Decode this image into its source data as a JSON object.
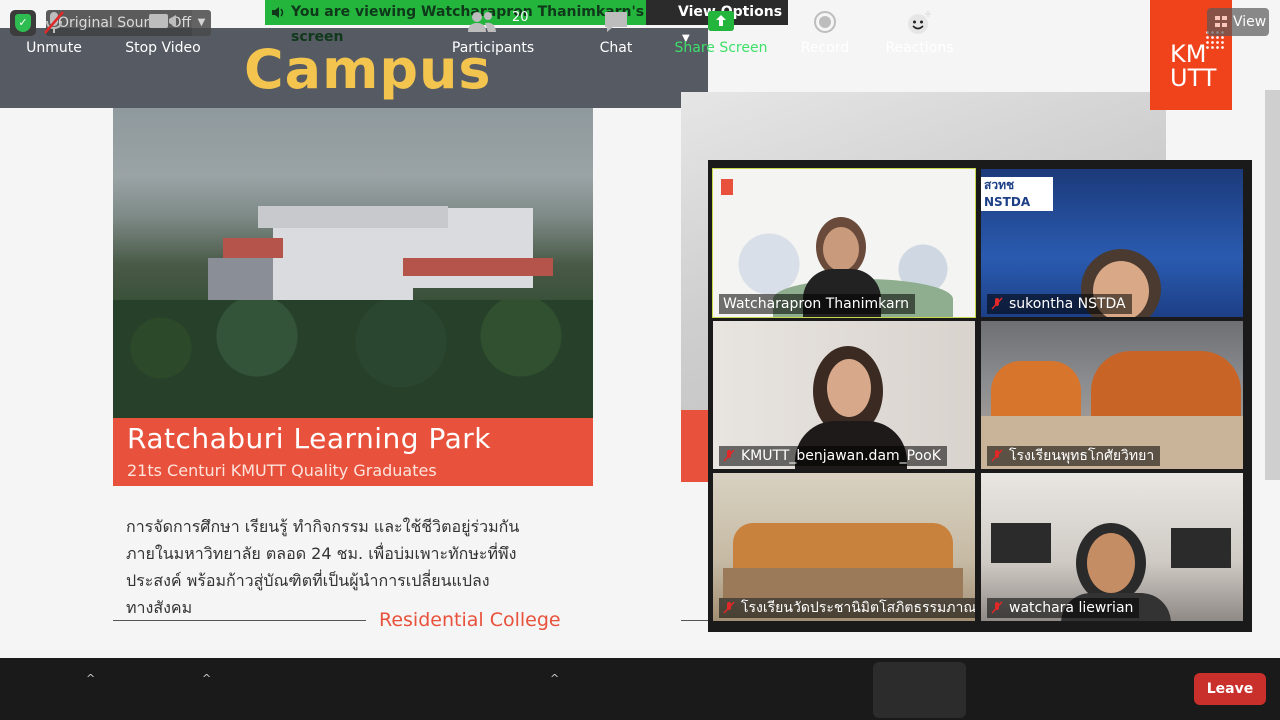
{
  "slide": {
    "title": "Campus",
    "park_title": "Ratchaburi Learning Park",
    "park_subtitle": "21ts Centuri KMUTT Quality Graduates",
    "thai_lines": [
      "การจัดการศึกษา เรียนรู้ ทำกิจกรรม และใช้ชีวิตอยู่ร่วมกัน",
      "ภายในมหาวิทยาลัย ตลอด 24 ชม. เพื่อบ่มเพาะทักษะที่พึง",
      "ประสงค์ พร้อมก้าวสู่บัณฑิตที่เป็นผู้นำการเปลี่ยนแปลง",
      "ทางสังคม"
    ],
    "residential": "Residential College",
    "logo_text": "KM UTT"
  },
  "topbar": {
    "original_sound": "Original Sound: Off",
    "share_banner": "You are viewing Watcharapron Thanimkarn's screen",
    "view_options": "View Options",
    "view": "View"
  },
  "participants": [
    {
      "name": "Watcharapron Thanimkarn",
      "muted": false,
      "active": true
    },
    {
      "name": "sukontha NSTDA",
      "muted": true
    },
    {
      "name": "KMUTT_benjawan.dam_PooK",
      "muted": true
    },
    {
      "name": "โรงเรียนพุทธโกศัยวิทยา",
      "muted": true
    },
    {
      "name": "โรงเรียนวัดประชานิมิตโสภิตธรรมภาณ",
      "muted": true
    },
    {
      "name": "watchara liewrian",
      "muted": true
    }
  ],
  "thumb": {
    "nstda_logo": "สวทช NSTDA"
  },
  "toolbar": {
    "unmute": "Unmute",
    "stop_video": "Stop Video",
    "participants": "Participants",
    "participants_count": "20",
    "chat": "Chat",
    "share_screen": "Share Screen",
    "record": "Record",
    "reactions": "Reactions",
    "leave": "Leave"
  },
  "colors": {
    "accent_red": "#e8513b",
    "share_green": "#23b53c",
    "title_yellow": "#f3c54f",
    "active_speaker": "#c7d84a",
    "leave_red": "#c9302c"
  }
}
